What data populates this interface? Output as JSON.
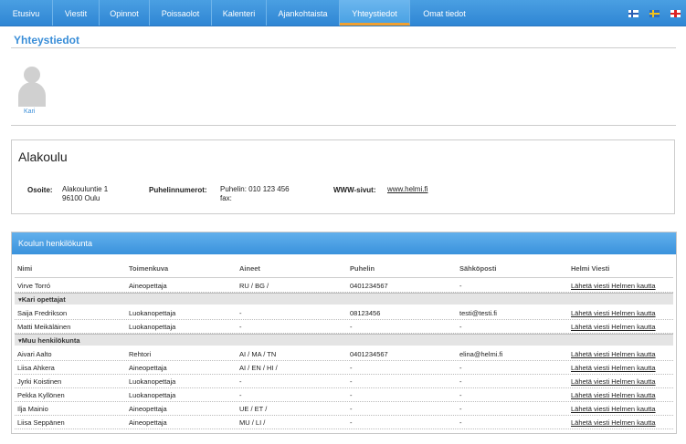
{
  "nav": {
    "tabs": [
      "Etusivu",
      "Viestit",
      "Opinnot",
      "Poissaolot",
      "Kalenteri",
      "Ajankohtaista",
      "Yhteystiedot",
      "Omat tiedot"
    ],
    "active": "Yhteystiedot",
    "languages": [
      "fi-flag",
      "se-flag",
      "gb-flag"
    ]
  },
  "page": {
    "title": "Yhteystiedot"
  },
  "user": {
    "name": "Kari"
  },
  "school": {
    "name": "Alakoulu",
    "address_label": "Osoite:",
    "address_line1": "Alakouluntie 1",
    "address_line2": "96100 Oulu",
    "phone_label": "Puhelinnumerot:",
    "phone_line1": "Puhelin: 010 123 456",
    "phone_line2": "fax:",
    "web_label": "WWW-sivut:",
    "web_link": "www.helmi.fi"
  },
  "staff": {
    "title": "Koulun henkilökunta",
    "columns": [
      "Nimi",
      "Toimenkuva",
      "Aineet",
      "Puhelin",
      "Sähköposti",
      "Helmi Viesti"
    ],
    "rows": [
      {
        "name": "Virve Torró",
        "role": "Aineopettaja",
        "subjects": "RU / BG /",
        "phone": "0401234567",
        "email": "-",
        "msg": "Lähetä viesti Helmen kautta"
      },
      {
        "group": "Kari opettajat"
      },
      {
        "name": "Saija Fredrikson",
        "role": "Luokanopettaja",
        "subjects": "-",
        "phone": "08123456",
        "email": "testi@testi.fi",
        "msg": "Lähetä viesti Helmen kautta"
      },
      {
        "name": "Matti Meikäläinen",
        "role": "Luokanopettaja",
        "subjects": "-",
        "phone": "-",
        "email": "-",
        "msg": "Lähetä viesti Helmen kautta"
      },
      {
        "group": "Muu henkilökunta"
      },
      {
        "name": "Aivari Aalto",
        "role": "Rehtori",
        "subjects": "AI / MA / TN",
        "phone": "0401234567",
        "email": "elina@helmi.fi",
        "msg": "Lähetä viesti Helmen kautta"
      },
      {
        "name": "Liisa Ahkera",
        "role": "Aineopettaja",
        "subjects": "AI / EN / HI /",
        "phone": "-",
        "email": "-",
        "msg": "Lähetä viesti Helmen kautta"
      },
      {
        "name": "Jyrki Koistinen",
        "role": "Luokanopettaja",
        "subjects": "-",
        "phone": "-",
        "email": "-",
        "msg": "Lähetä viesti Helmen kautta"
      },
      {
        "name": "Pekka Kyllönen",
        "role": "Luokanopettaja",
        "subjects": "-",
        "phone": "-",
        "email": "-",
        "msg": "Lähetä viesti Helmen kautta"
      },
      {
        "name": "Ilja Mainio",
        "role": "Aineopettaja",
        "subjects": "UE / ET /",
        "phone": "-",
        "email": "-",
        "msg": "Lähetä viesti Helmen kautta"
      },
      {
        "name": "Liisa Seppänen",
        "role": "Aineopettaja",
        "subjects": "MU / LI /",
        "phone": "-",
        "email": "-",
        "msg": "Lähetä viesti Helmen kautta"
      }
    ]
  }
}
